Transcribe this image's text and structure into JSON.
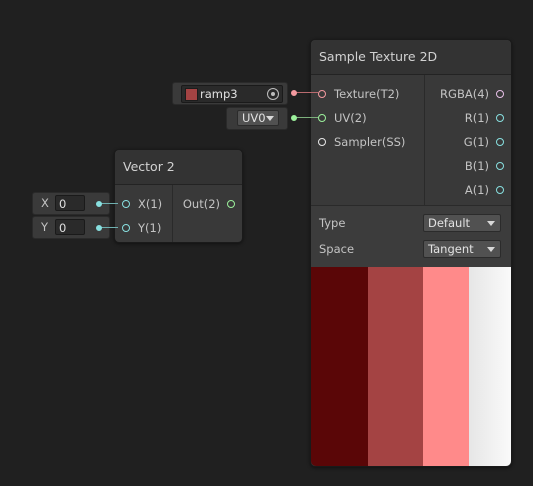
{
  "sample_node": {
    "title": "Sample Texture 2D",
    "inputs": [
      {
        "label": "Texture(T2)",
        "color": "#f49aa0"
      },
      {
        "label": "UV(2)",
        "color": "#9bf09b"
      },
      {
        "label": "Sampler(SS)",
        "color": "#e8e8e8"
      }
    ],
    "outputs": [
      {
        "label": "RGBA(4)",
        "color": "#e8c0e8"
      },
      {
        "label": "R(1)",
        "color": "#88e0e0"
      },
      {
        "label": "G(1)",
        "color": "#88e0e0"
      },
      {
        "label": "B(1)",
        "color": "#88e0e0"
      },
      {
        "label": "A(1)",
        "color": "#88e0e0"
      }
    ],
    "type_label": "Type",
    "type_value": "Default",
    "space_label": "Space",
    "space_value": "Tangent",
    "preview_colors": [
      "#5a0607",
      "#a44343",
      "#ff8a8a",
      "#efefef"
    ]
  },
  "texture_field": {
    "value": "ramp3",
    "swatch_color": "#a44343"
  },
  "uv_field": {
    "value": "UV0"
  },
  "vector2_node": {
    "title": "Vector 2",
    "inputs": [
      {
        "label": "X(1)",
        "color": "#88e0e0"
      },
      {
        "label": "Y(1)",
        "color": "#88e0e0"
      }
    ],
    "output": {
      "label": "Out(2)",
      "color": "#9bf09b"
    }
  },
  "x_field": {
    "label": "X",
    "value": "0"
  },
  "y_field": {
    "label": "Y",
    "value": "0"
  }
}
